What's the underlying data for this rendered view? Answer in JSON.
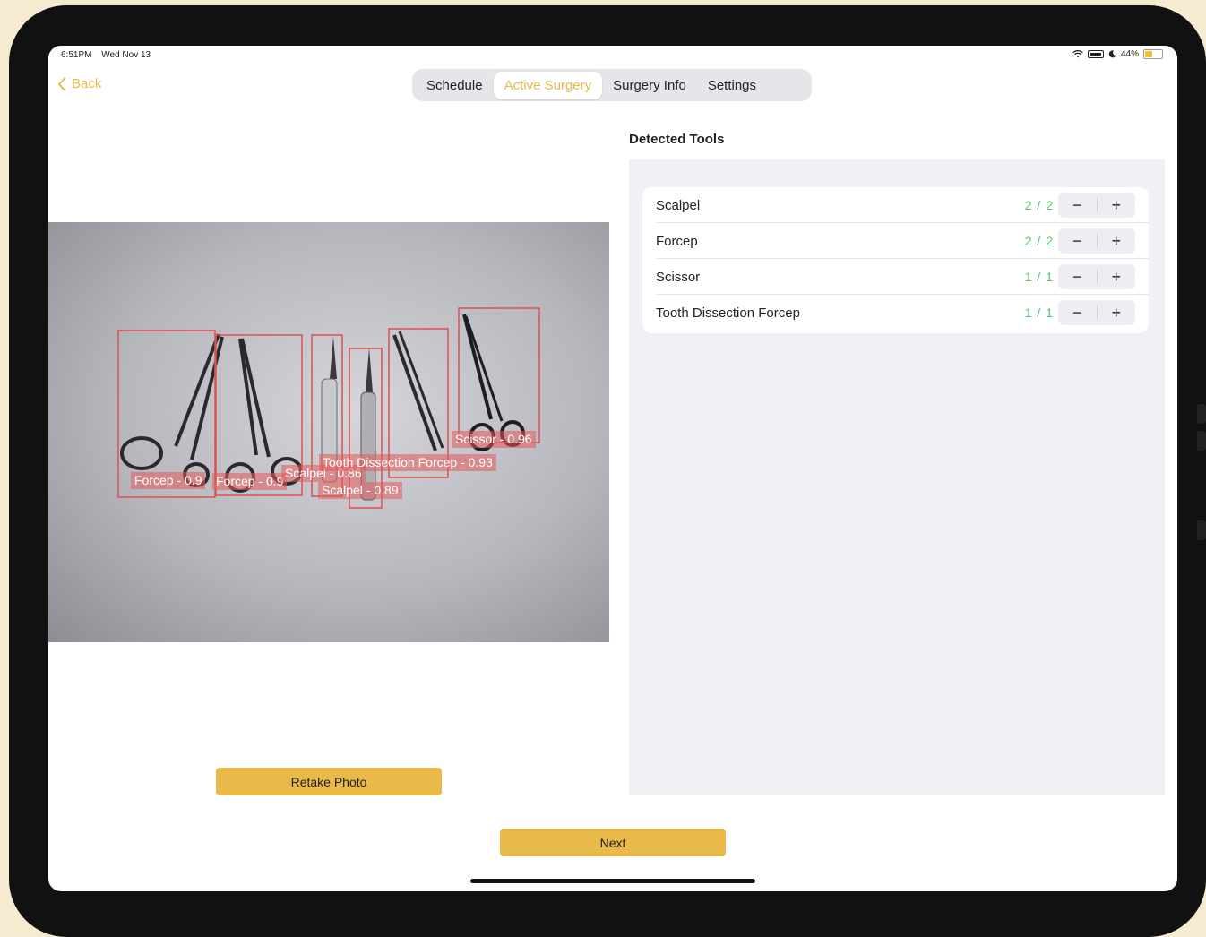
{
  "status_bar": {
    "time": "6:51PM",
    "date": "Wed Nov 13",
    "battery_percent": "44%",
    "battery_level": 0.44
  },
  "nav": {
    "back_label": "Back",
    "tabs": [
      {
        "label": "Schedule",
        "active": false
      },
      {
        "label": "Active Surgery",
        "active": true
      },
      {
        "label": "Surgery Info",
        "active": false
      },
      {
        "label": "Settings",
        "active": false
      }
    ]
  },
  "photo": {
    "detections": [
      {
        "label": "Forcep - 0.9"
      },
      {
        "label": "Forcep - 0.9"
      },
      {
        "label": "Scalpel - 0.86"
      },
      {
        "label": "Scalpel - 0.89"
      },
      {
        "label": "Tooth Dissection Forcep - 0.93"
      },
      {
        "label": "Scissor - 0.96"
      }
    ]
  },
  "detected_tools": {
    "title": "Detected Tools",
    "items": [
      {
        "name": "Scalpel",
        "count": "2 / 2"
      },
      {
        "name": "Forcep",
        "count": "2 / 2"
      },
      {
        "name": "Scissor",
        "count": "1 / 1"
      },
      {
        "name": "Tooth Dissection Forcep",
        "count": "1 / 1"
      }
    ],
    "minus": "−",
    "plus": "+"
  },
  "buttons": {
    "retake": "Retake Photo",
    "next": "Next"
  },
  "colors": {
    "accent": "#e9b949",
    "count_green": "#5cc16a",
    "detection_box": "#e0504f"
  }
}
